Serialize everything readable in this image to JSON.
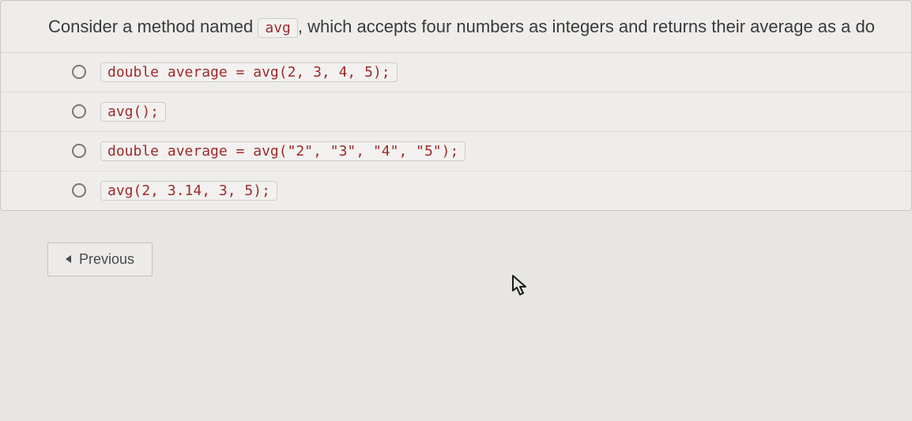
{
  "question": {
    "prefix": "Consider a method named ",
    "code_chip": "avg",
    "suffix": ", which accepts four numbers as integers and returns their average as a do"
  },
  "options": [
    {
      "code": "double average = avg(2, 3, 4, 5);"
    },
    {
      "code": "avg();"
    },
    {
      "code": "double average = avg(\"2\", \"3\", \"4\", \"5\");"
    },
    {
      "code": "avg(2, 3.14, 3, 5);"
    }
  ],
  "nav": {
    "previous_label": "Previous"
  }
}
